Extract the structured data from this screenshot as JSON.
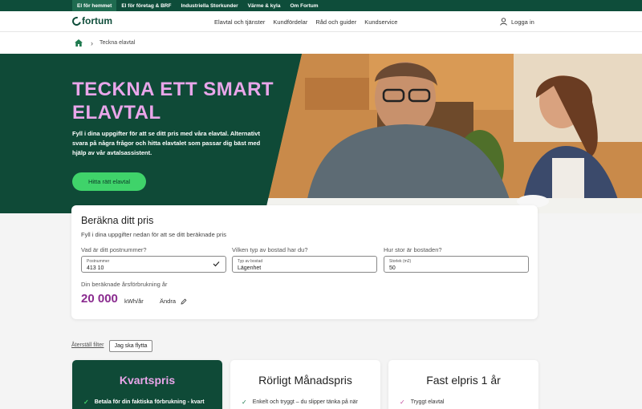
{
  "topbar": {
    "items": [
      "El för hemmet",
      "El för företag & BRF",
      "Industriella Storkunder",
      "Värme & kyla",
      "Om Fortum"
    ]
  },
  "header": {
    "logo_text": "fortum",
    "nav": [
      "Elavtal och tjänster",
      "Kundfördelar",
      "Råd och guider",
      "Kundservice"
    ],
    "login_label": "Logga in"
  },
  "breadcrumb": {
    "current": "Teckna elavtal"
  },
  "hero": {
    "title": "TECKNA ETT SMART ELAVTAL",
    "text": "Fyll i dina uppgifter för att se ditt pris med våra elavtal. Alternativt svara på några frågor och hitta elavtalet som passar dig bäst med hjälp av vår avtalsassistent.",
    "cta_label": "Hitta rätt elavtal"
  },
  "calculator": {
    "title": "Beräkna ditt pris",
    "subtitle": "Fyll i dina uppgifter nedan för att se ditt beräknade pris",
    "postal": {
      "question": "Vad är ditt postnummer?",
      "label": "Postnummer",
      "value": "413 10"
    },
    "housing": {
      "question": "Vilken typ av bostad har du?",
      "label": "Typ av bostad",
      "value": "Lägenhet"
    },
    "size": {
      "question": "Hur stor är bostaden?",
      "label": "Storlek (m2)",
      "value": "50"
    },
    "usage_label": "Din beräknade årsförbrukning år",
    "usage_value": "20 000",
    "usage_unit": "kWh/år",
    "change_label": "Ändra"
  },
  "filters": {
    "reset_label": "Återställ filter",
    "move_label": "Jag ska flytta"
  },
  "products": [
    {
      "title": "Kvartspris",
      "item": "Betala för din faktiska förbrukning - kvart"
    },
    {
      "title": "Rörligt Månadspris",
      "item": "Enkelt och tryggt – du slipper tänka på när"
    },
    {
      "title": "Fast elpris 1 år",
      "item": "Tryggt elavtal"
    }
  ],
  "colors": {
    "brand_green": "#0f4a37",
    "accent_pink": "#e9a6ea",
    "cta_green": "#3fd36a",
    "usage_purple": "#8a2b8f"
  }
}
